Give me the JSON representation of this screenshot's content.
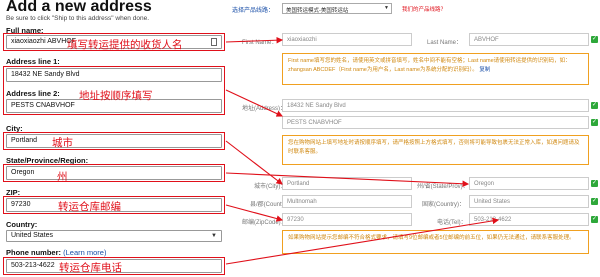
{
  "left": {
    "title": "Add a new address",
    "hint": "Be sure to click \"Ship to this address\" when done.",
    "full_name": {
      "label": "Full name:",
      "value": "xiaoxiaozhi ABVHOF"
    },
    "address1": {
      "label": "Address line 1:",
      "value": "18432 NE Sandy Blvd"
    },
    "address2": {
      "label": "Address line 2:",
      "value": "PESTS CNABVHOF"
    },
    "city": {
      "label": "City:",
      "value": "Portland"
    },
    "state": {
      "label": "State/Province/Region:",
      "value": "Oregon"
    },
    "zip": {
      "label": "ZIP:",
      "value": "97230"
    },
    "country": {
      "label": "Country:",
      "value": "United States"
    },
    "phone": {
      "label": "Phone number:",
      "learn_more": "(Learn more)",
      "value": "503-213-4622"
    }
  },
  "annotations": {
    "name": "填写转运提供的收货人名",
    "address": "地址按顺序填写",
    "city": "城市",
    "state": "州",
    "zip": "转运仓库邮编",
    "phone": "转运仓库电话"
  },
  "right": {
    "product_line_label": "选择产品线路：",
    "product_line_value": "美国转运模式-美国转运站",
    "help_link": "我们的产品线路？",
    "first_name_label": "First Name：",
    "first_name_value": "xiaoxiaozhi",
    "last_name_label": "Last Name：",
    "last_name_value": "ABVHOF",
    "tip_name": "First name填写您的姓名，请使用英文或拼音填写，姓名中间不能有空格；Last name请使用转运提供的识别码，如：zhangsan ABCDEF（First name为用户名，Last name为系统分配的识别码）。",
    "tip_name_link": "复制",
    "address_label": "地址(Address)：",
    "address1_value": "18432 NE Sandy Blvd",
    "address2_value": "PESTS CNABVHOF",
    "tip_address": "您在购物网站上填写地址时请按顺序填写，请严格按照上方格式填写，否则将可能导致包裹无法正常入库，如遇问题请及时联系客服。",
    "city_label": "城市(City)：",
    "city_value": "Portland",
    "state_label": "州/省(State/Prov)：",
    "state_value": "Oregon",
    "county_label": "县/郡(County)：",
    "county_value": "Multnomah",
    "country_label": "国家(Country)：",
    "country_value": "United States",
    "zip_label": "邮编(ZipCode)：",
    "zip_value": "97230",
    "tel_label": "电话(Tel)：",
    "tel_value": "503-213-4622",
    "tip_zip": "如果购物网站提示您邮编不符合格式要求，请填写9位邮编或者5位邮编的前五位，如果仍无法通过，请联系客服处理。"
  },
  "colors": {
    "annotation_red": "#e0101a",
    "tip_orange": "#f0a020",
    "check_green": "#2ea83a"
  }
}
